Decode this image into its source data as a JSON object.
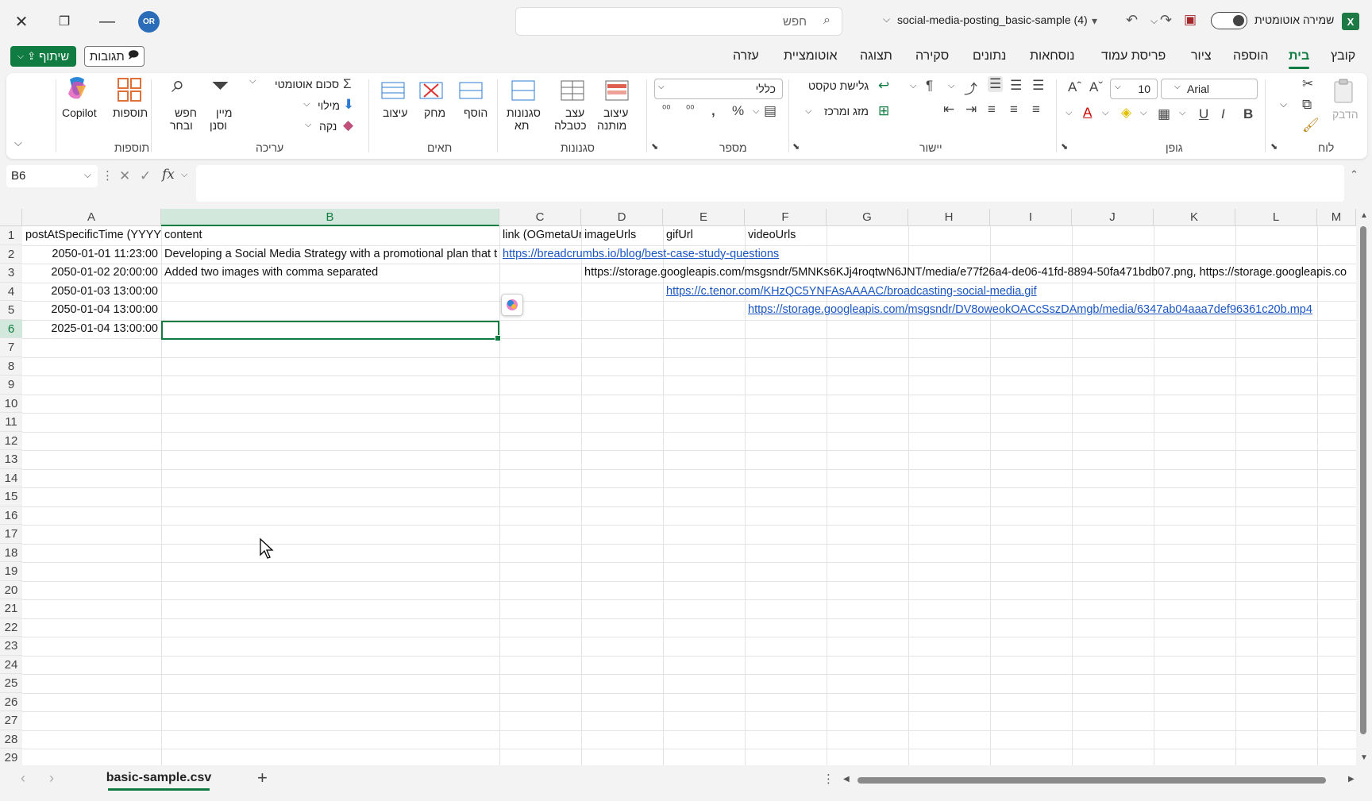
{
  "window": {
    "file_title": "social-media-posting_basic-sample (4)",
    "autosave_label": "שמירה אוטומטית",
    "search_placeholder": "חפש",
    "avatar_initials": "OR",
    "app_letter": "X"
  },
  "menu": {
    "tabs": [
      "קובץ",
      "בית",
      "הוספה",
      "ציור",
      "פריסת עמוד",
      "נוסחאות",
      "נתונים",
      "סקירה",
      "תצוגה",
      "אוטומציית",
      "עזרה"
    ],
    "active_tab": "בית",
    "share_label": "שיתוף",
    "comments_label": "תגובות"
  },
  "ribbon": {
    "groups": {
      "clipboard": "לוח",
      "font": "גופן",
      "alignment": "יישור",
      "number": "מספר",
      "styles": "סגנונות",
      "cells": "תאים",
      "editing": "עריכה",
      "addins": "תוספות"
    },
    "paste": "הדבק",
    "font_name": "Arial",
    "font_size": "10",
    "wrap_text": "גלישת טקסט",
    "merge_center": "מזג ומרכז",
    "number_format": "כללי",
    "conditional_formatting": [
      "עיצוב",
      "מותנה"
    ],
    "format_as_table": [
      "עצב",
      "כטבלה"
    ],
    "cell_styles": [
      "סגנונות",
      "תא"
    ],
    "insert": "הוסף",
    "delete": "מחק",
    "format": "עיצוב",
    "autosum": "סכום אוטומטי",
    "fill": "מילוי",
    "clear": "נקה",
    "sort_filter": [
      "מיין",
      "וסנן"
    ],
    "find_select": [
      "חפש",
      "ובחר"
    ],
    "addins": "תוספות",
    "copilot": "Copilot"
  },
  "formula_bar": {
    "name_box": "B6",
    "formula": ""
  },
  "grid": {
    "columns": [
      "A",
      "B",
      "C",
      "D",
      "E",
      "F",
      "G",
      "H",
      "I",
      "J",
      "K",
      "L",
      "M"
    ],
    "selected_column": "B",
    "rows": [
      "1",
      "2",
      "3",
      "4",
      "5",
      "6",
      "7",
      "8",
      "9",
      "10",
      "11",
      "12",
      "13",
      "14",
      "15",
      "16",
      "17",
      "18",
      "19",
      "20",
      "21",
      "22",
      "23",
      "24",
      "25",
      "26",
      "27",
      "28",
      "29"
    ],
    "selected_row": "6",
    "cells": {
      "A1": "postAtSpecificTime (YYYY",
      "B1": "content",
      "C1": "link (OGmetaUr",
      "D1": "imageUrls",
      "E1": "gifUrl",
      "F1": "videoUrls",
      "A2": "2050-01-01 11:23:00",
      "B2": "Developing a Social Media Strategy with a promotional plan that t",
      "C2": "https://breadcrumbs.io/blog/best-case-study-questions",
      "A3": "2050-01-02 20:00:00",
      "B3": "Added two images with comma separated",
      "D3": "https://storage.googleapis.com/msgsndr/5MNKs6KJj4roqtwN6JNT/media/e77f26a4-de06-41fd-8894-50fa471bdb07.png, https://storage.googleapis.co",
      "A4": "2050-01-03 13:00:00",
      "E4": "https://c.tenor.com/KHzQC5YNFAsAAAAC/broadcasting-social-media.gif",
      "A5": "2050-01-04 13:00:00",
      "F5": "https://storage.googleapis.com/msgsndr/DV8oweokOACcSszDAmgb/media/6347ab04aaa7def96361c20b.mp4",
      "A6": "2025-01-04 13:00:00"
    }
  },
  "sheets": {
    "active": "basic-sample.csv",
    "add_label": "+"
  },
  "colors": {
    "accent": "#107c41",
    "link": "#1a55c4"
  }
}
